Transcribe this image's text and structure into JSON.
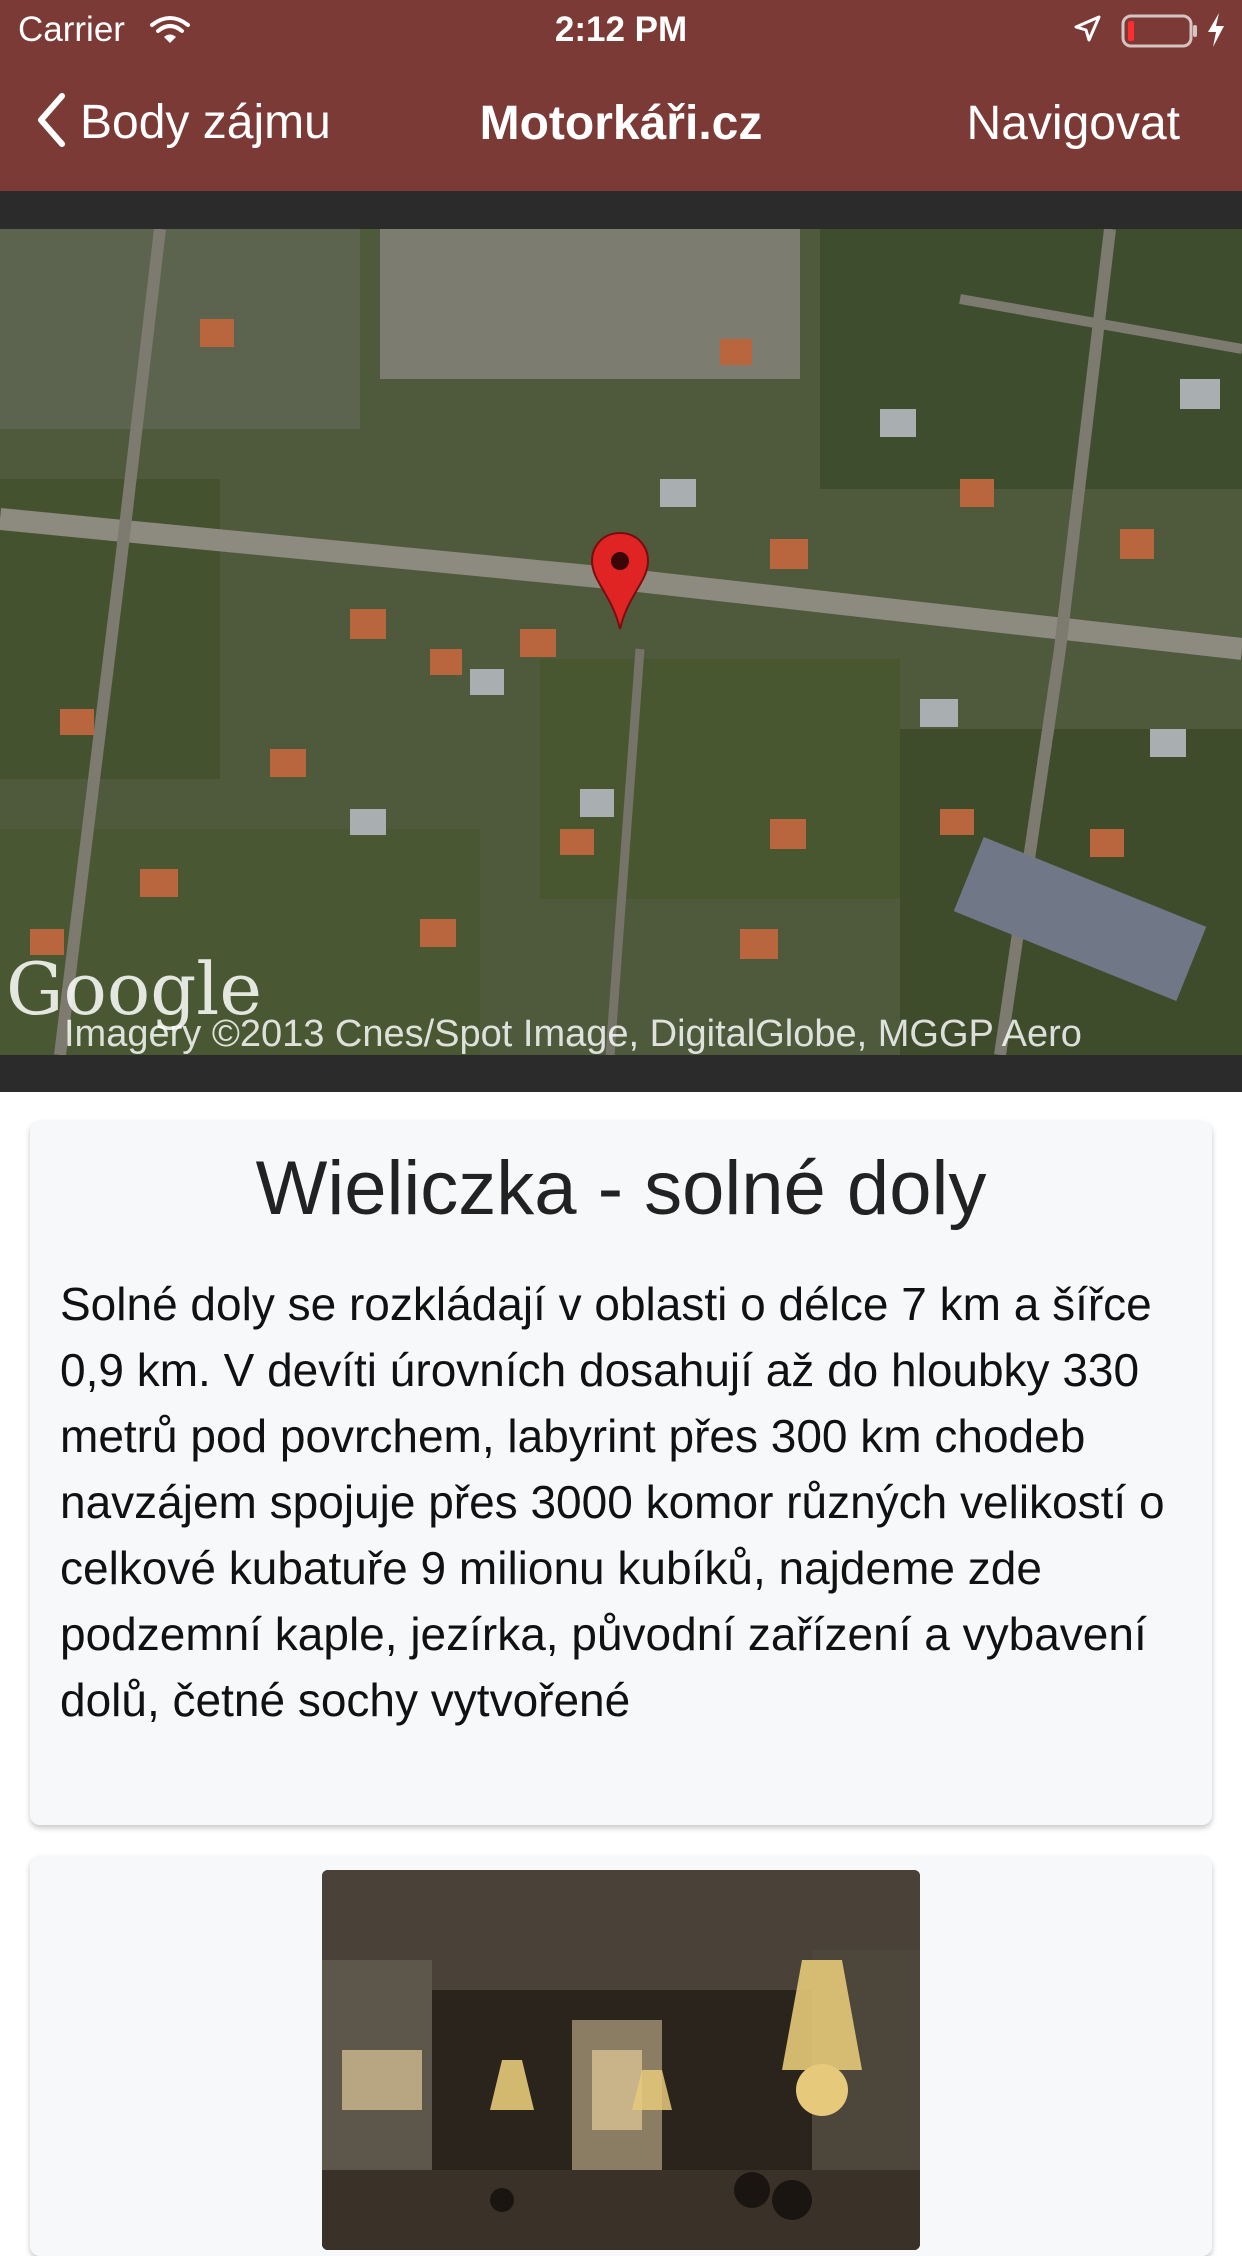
{
  "status_bar": {
    "carrier": "Carrier",
    "time": "2:12 PM",
    "icons": [
      "wifi-icon",
      "location-icon",
      "battery-icon",
      "charging-icon"
    ]
  },
  "nav": {
    "back_label": "Body zájmu",
    "title": "Motorkáři.cz",
    "navigate_label": "Navigovat"
  },
  "map": {
    "logo": "Google",
    "attribution": "Imagery ©2013 Cnes/Spot Image, DigitalGlobe, MGGP Aero",
    "pin": "map-pin-icon"
  },
  "place": {
    "title": "Wieliczka - solné doly",
    "description": "Solné doly se rozkládají v oblasti o délce 7 km a šířce 0,9 km. V devíti úrovních dosahují až do hloubky 330 metrů pod povrchem, labyrint přes 300 km chodeb navzájem spojuje přes 3000 komor různých velikostí o celkové kubatuře 9 milionu kubíků, najdeme zde podzemní kaple, jezírka, původní zařízení a vybavení dolů, četné sochy vytvořené"
  },
  "colors": {
    "header": "#7b3a35",
    "map_frame": "#2b2b2b",
    "card_background": "#f6f8fa",
    "pin": "#e02424"
  }
}
